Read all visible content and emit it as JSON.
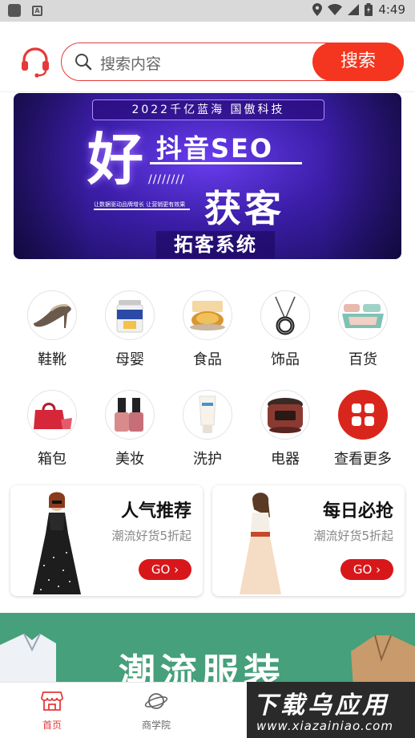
{
  "status_bar": {
    "time": "4:49"
  },
  "search": {
    "placeholder": "搜索内容",
    "button_label": "搜索"
  },
  "banner": {
    "tag": "2022千亿蓝海 国傲科技",
    "hao": "好",
    "line1": "抖音SEO",
    "slashes": "////////",
    "line2": "获客",
    "small_text": "让数据驱动品牌增长 让营销更有效果",
    "line3": "拓客系统"
  },
  "categories": [
    {
      "label": "鞋靴",
      "icon": "high-heel-shoe"
    },
    {
      "label": "母婴",
      "icon": "milk-formula-can"
    },
    {
      "label": "食品",
      "icon": "pastry"
    },
    {
      "label": "饰品",
      "icon": "necklace"
    },
    {
      "label": "百货",
      "icon": "bedding"
    },
    {
      "label": "箱包",
      "icon": "handbag"
    },
    {
      "label": "美妆",
      "icon": "nail-polish"
    },
    {
      "label": "洗护",
      "icon": "lotion-tube"
    },
    {
      "label": "电器",
      "icon": "rice-cooker"
    },
    {
      "label": "查看更多",
      "icon": "grid-more"
    }
  ],
  "promos": [
    {
      "title": "人气推荐",
      "subtitle": "潮流好货5折起",
      "go": "GO"
    },
    {
      "title": "每日必抢",
      "subtitle": "潮流好货5折起",
      "go": "GO"
    }
  ],
  "fashion_banner": {
    "text": "潮流服装"
  },
  "tabs": [
    {
      "label": "首页",
      "active": true
    },
    {
      "label": "商学院",
      "active": false
    }
  ],
  "watermark": {
    "line1": "下载乌应用",
    "line2": "www.xiazainiao.com"
  },
  "colors": {
    "accent": "#e63939",
    "search_button": "#f4351f",
    "go_button": "#d8171b",
    "fashion_bg": "#45a07b"
  }
}
